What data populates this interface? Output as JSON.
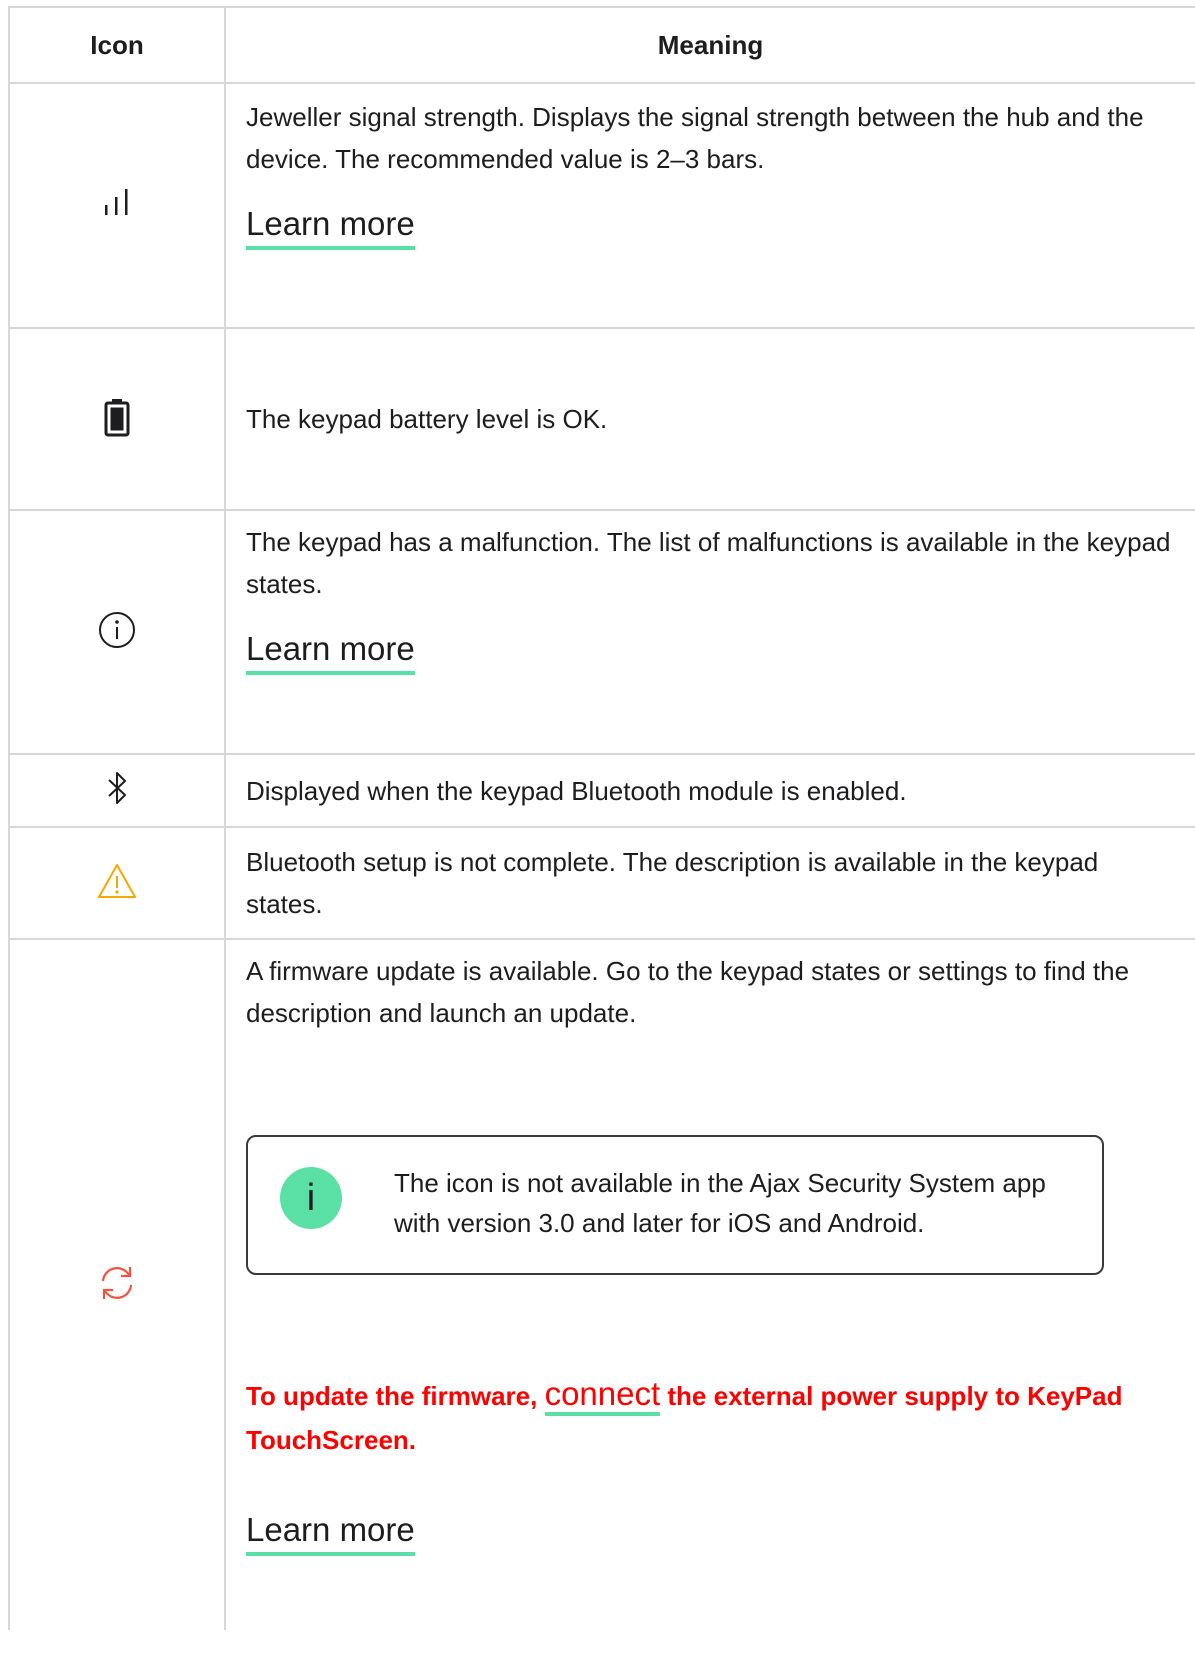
{
  "table": {
    "header": {
      "icon": "Icon",
      "meaning": "Meaning"
    },
    "rows": [
      {
        "icon": "signal-strength-icon",
        "text": "Jeweller signal strength. Displays the signal strength between the hub and the device. The recommended value is 2–3 bars.",
        "link": "Learn more"
      },
      {
        "icon": "battery-full-icon",
        "text": "The keypad battery level is OK."
      },
      {
        "icon": "info-icon",
        "text": "The keypad has a malfunction. The list of malfunctions is available in the keypad states.",
        "link": "Learn more"
      },
      {
        "icon": "bluetooth-icon",
        "text": "Displayed when the keypad Bluetooth module is enabled."
      },
      {
        "icon": "warning-triangle-icon",
        "text": "Bluetooth setup is not complete. The description is available in the keypad states."
      },
      {
        "icon": "firmware-update-icon",
        "text": "A firmware update is available. Go to the keypad states or settings to find the description and launch an update.",
        "note": {
          "badge": "i",
          "text": "The icon is not available in the Ajax Security System app with version 3.0 and later for iOS and Android."
        },
        "warning": {
          "before": "To update the firmware, ",
          "link": "connect",
          "after": " the external power supply to KeyPad TouchScreen."
        },
        "link": "Learn more"
      }
    ]
  },
  "colors": {
    "accent": "#5ae0a4",
    "warning_icon": "#f5a800",
    "update_icon": "#f0533f",
    "warning_text": "#ff0000",
    "border": "#d7d7d7"
  }
}
